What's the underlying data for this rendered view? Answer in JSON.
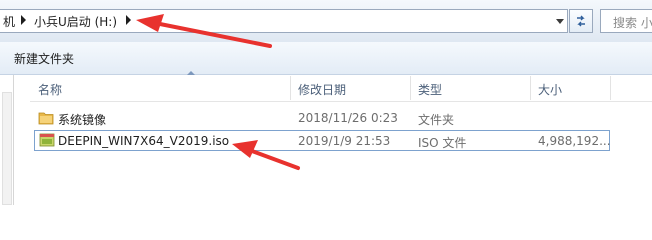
{
  "address_bar": {
    "crumbs": [
      "机",
      "小兵U启动 (H:)"
    ],
    "search_placeholder": "搜索 小"
  },
  "toolbar": {
    "new_folder_label": "新建文件夹"
  },
  "columns": {
    "name": "名称",
    "modified": "修改日期",
    "type": "类型",
    "size": "大小"
  },
  "files": [
    {
      "name": "系统镜像",
      "modified": "2018/11/26 0:23",
      "type": "文件夹",
      "size": "",
      "icon": "folder-icon"
    },
    {
      "name": "DEEPIN_WIN7X64_V2019.iso",
      "modified": "2019/1/9 21:53",
      "type": "ISO 文件",
      "size": "4,988,192...",
      "icon": "iso-file-icon"
    }
  ],
  "colors": {
    "annotation_arrow": "#e8322e",
    "selection_border": "#7da2ce",
    "header_text": "#4c607a"
  }
}
